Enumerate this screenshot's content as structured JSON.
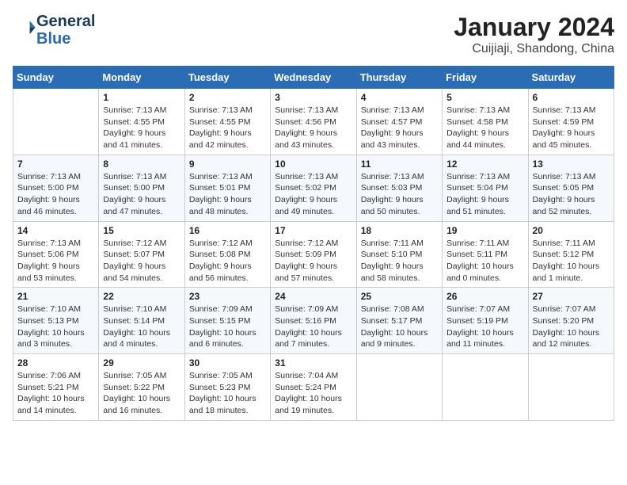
{
  "header": {
    "logo_general": "General",
    "logo_blue": "Blue",
    "month_title": "January 2024",
    "location": "Cuijiaji, Shandong, China"
  },
  "weekdays": [
    "Sunday",
    "Monday",
    "Tuesday",
    "Wednesday",
    "Thursday",
    "Friday",
    "Saturday"
  ],
  "weeks": [
    [
      {
        "day": "",
        "sunrise": "",
        "sunset": "",
        "daylight": ""
      },
      {
        "day": "1",
        "sunrise": "Sunrise: 7:13 AM",
        "sunset": "Sunset: 4:55 PM",
        "daylight": "Daylight: 9 hours and 41 minutes."
      },
      {
        "day": "2",
        "sunrise": "Sunrise: 7:13 AM",
        "sunset": "Sunset: 4:55 PM",
        "daylight": "Daylight: 9 hours and 42 minutes."
      },
      {
        "day": "3",
        "sunrise": "Sunrise: 7:13 AM",
        "sunset": "Sunset: 4:56 PM",
        "daylight": "Daylight: 9 hours and 43 minutes."
      },
      {
        "day": "4",
        "sunrise": "Sunrise: 7:13 AM",
        "sunset": "Sunset: 4:57 PM",
        "daylight": "Daylight: 9 hours and 43 minutes."
      },
      {
        "day": "5",
        "sunrise": "Sunrise: 7:13 AM",
        "sunset": "Sunset: 4:58 PM",
        "daylight": "Daylight: 9 hours and 44 minutes."
      },
      {
        "day": "6",
        "sunrise": "Sunrise: 7:13 AM",
        "sunset": "Sunset: 4:59 PM",
        "daylight": "Daylight: 9 hours and 45 minutes."
      }
    ],
    [
      {
        "day": "7",
        "sunrise": "Sunrise: 7:13 AM",
        "sunset": "Sunset: 5:00 PM",
        "daylight": "Daylight: 9 hours and 46 minutes."
      },
      {
        "day": "8",
        "sunrise": "Sunrise: 7:13 AM",
        "sunset": "Sunset: 5:00 PM",
        "daylight": "Daylight: 9 hours and 47 minutes."
      },
      {
        "day": "9",
        "sunrise": "Sunrise: 7:13 AM",
        "sunset": "Sunset: 5:01 PM",
        "daylight": "Daylight: 9 hours and 48 minutes."
      },
      {
        "day": "10",
        "sunrise": "Sunrise: 7:13 AM",
        "sunset": "Sunset: 5:02 PM",
        "daylight": "Daylight: 9 hours and 49 minutes."
      },
      {
        "day": "11",
        "sunrise": "Sunrise: 7:13 AM",
        "sunset": "Sunset: 5:03 PM",
        "daylight": "Daylight: 9 hours and 50 minutes."
      },
      {
        "day": "12",
        "sunrise": "Sunrise: 7:13 AM",
        "sunset": "Sunset: 5:04 PM",
        "daylight": "Daylight: 9 hours and 51 minutes."
      },
      {
        "day": "13",
        "sunrise": "Sunrise: 7:13 AM",
        "sunset": "Sunset: 5:05 PM",
        "daylight": "Daylight: 9 hours and 52 minutes."
      }
    ],
    [
      {
        "day": "14",
        "sunrise": "Sunrise: 7:13 AM",
        "sunset": "Sunset: 5:06 PM",
        "daylight": "Daylight: 9 hours and 53 minutes."
      },
      {
        "day": "15",
        "sunrise": "Sunrise: 7:12 AM",
        "sunset": "Sunset: 5:07 PM",
        "daylight": "Daylight: 9 hours and 54 minutes."
      },
      {
        "day": "16",
        "sunrise": "Sunrise: 7:12 AM",
        "sunset": "Sunset: 5:08 PM",
        "daylight": "Daylight: 9 hours and 56 minutes."
      },
      {
        "day": "17",
        "sunrise": "Sunrise: 7:12 AM",
        "sunset": "Sunset: 5:09 PM",
        "daylight": "Daylight: 9 hours and 57 minutes."
      },
      {
        "day": "18",
        "sunrise": "Sunrise: 7:11 AM",
        "sunset": "Sunset: 5:10 PM",
        "daylight": "Daylight: 9 hours and 58 minutes."
      },
      {
        "day": "19",
        "sunrise": "Sunrise: 7:11 AM",
        "sunset": "Sunset: 5:11 PM",
        "daylight": "Daylight: 10 hours and 0 minutes."
      },
      {
        "day": "20",
        "sunrise": "Sunrise: 7:11 AM",
        "sunset": "Sunset: 5:12 PM",
        "daylight": "Daylight: 10 hours and 1 minute."
      }
    ],
    [
      {
        "day": "21",
        "sunrise": "Sunrise: 7:10 AM",
        "sunset": "Sunset: 5:13 PM",
        "daylight": "Daylight: 10 hours and 3 minutes."
      },
      {
        "day": "22",
        "sunrise": "Sunrise: 7:10 AM",
        "sunset": "Sunset: 5:14 PM",
        "daylight": "Daylight: 10 hours and 4 minutes."
      },
      {
        "day": "23",
        "sunrise": "Sunrise: 7:09 AM",
        "sunset": "Sunset: 5:15 PM",
        "daylight": "Daylight: 10 hours and 6 minutes."
      },
      {
        "day": "24",
        "sunrise": "Sunrise: 7:09 AM",
        "sunset": "Sunset: 5:16 PM",
        "daylight": "Daylight: 10 hours and 7 minutes."
      },
      {
        "day": "25",
        "sunrise": "Sunrise: 7:08 AM",
        "sunset": "Sunset: 5:17 PM",
        "daylight": "Daylight: 10 hours and 9 minutes."
      },
      {
        "day": "26",
        "sunrise": "Sunrise: 7:07 AM",
        "sunset": "Sunset: 5:19 PM",
        "daylight": "Daylight: 10 hours and 11 minutes."
      },
      {
        "day": "27",
        "sunrise": "Sunrise: 7:07 AM",
        "sunset": "Sunset: 5:20 PM",
        "daylight": "Daylight: 10 hours and 12 minutes."
      }
    ],
    [
      {
        "day": "28",
        "sunrise": "Sunrise: 7:06 AM",
        "sunset": "Sunset: 5:21 PM",
        "daylight": "Daylight: 10 hours and 14 minutes."
      },
      {
        "day": "29",
        "sunrise": "Sunrise: 7:05 AM",
        "sunset": "Sunset: 5:22 PM",
        "daylight": "Daylight: 10 hours and 16 minutes."
      },
      {
        "day": "30",
        "sunrise": "Sunrise: 7:05 AM",
        "sunset": "Sunset: 5:23 PM",
        "daylight": "Daylight: 10 hours and 18 minutes."
      },
      {
        "day": "31",
        "sunrise": "Sunrise: 7:04 AM",
        "sunset": "Sunset: 5:24 PM",
        "daylight": "Daylight: 10 hours and 19 minutes."
      },
      {
        "day": "",
        "sunrise": "",
        "sunset": "",
        "daylight": ""
      },
      {
        "day": "",
        "sunrise": "",
        "sunset": "",
        "daylight": ""
      },
      {
        "day": "",
        "sunrise": "",
        "sunset": "",
        "daylight": ""
      }
    ]
  ]
}
